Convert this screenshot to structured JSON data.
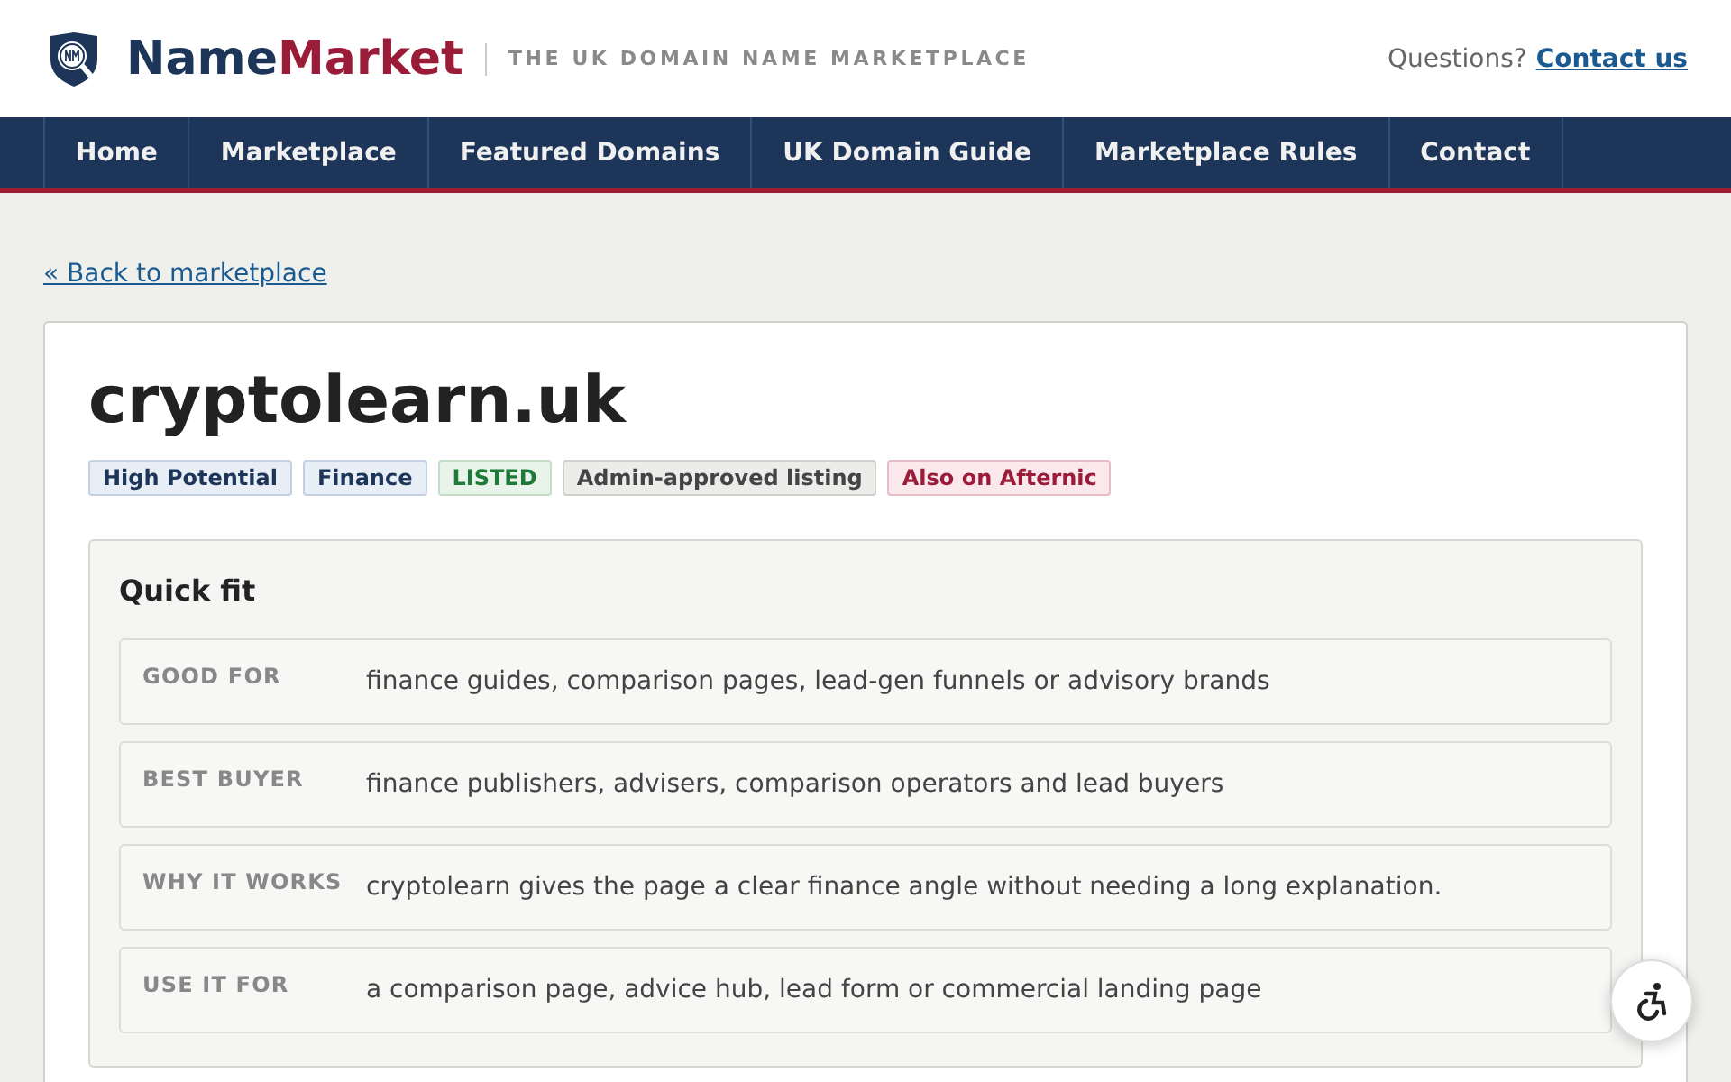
{
  "header": {
    "brand_first": "Name",
    "brand_second": "Market",
    "tagline": "THE UK DOMAIN NAME MARKETPLACE",
    "contact_prompt": "Questions?",
    "contact_link": "Contact us"
  },
  "nav": [
    "Home",
    "Marketplace",
    "Featured Domains",
    "UK Domain Guide",
    "Marketplace Rules",
    "Contact"
  ],
  "back_link": "« Back to marketplace",
  "domain": {
    "name": "cryptolearn.uk",
    "tags": [
      {
        "label": "High Potential",
        "kind": "info"
      },
      {
        "label": "Finance",
        "kind": "info"
      },
      {
        "label": "LISTED",
        "kind": "status"
      },
      {
        "label": "Admin-approved listing",
        "kind": "neutral"
      },
      {
        "label": "Also on Afternic",
        "kind": "external"
      }
    ]
  },
  "quick_fit": {
    "title": "Quick fit",
    "rows": [
      {
        "label": "GOOD FOR",
        "value": "finance guides, comparison pages, lead-gen funnels or advisory brands"
      },
      {
        "label": "BEST BUYER",
        "value": "finance publishers, advisers, comparison operators and lead buyers"
      },
      {
        "label": "WHY IT WORKS",
        "value": "cryptolearn gives the page a clear finance angle without needing a long explanation."
      },
      {
        "label": "USE IT FOR",
        "value": "a comparison page, advice hub, lead form or commercial landing page"
      }
    ]
  }
}
